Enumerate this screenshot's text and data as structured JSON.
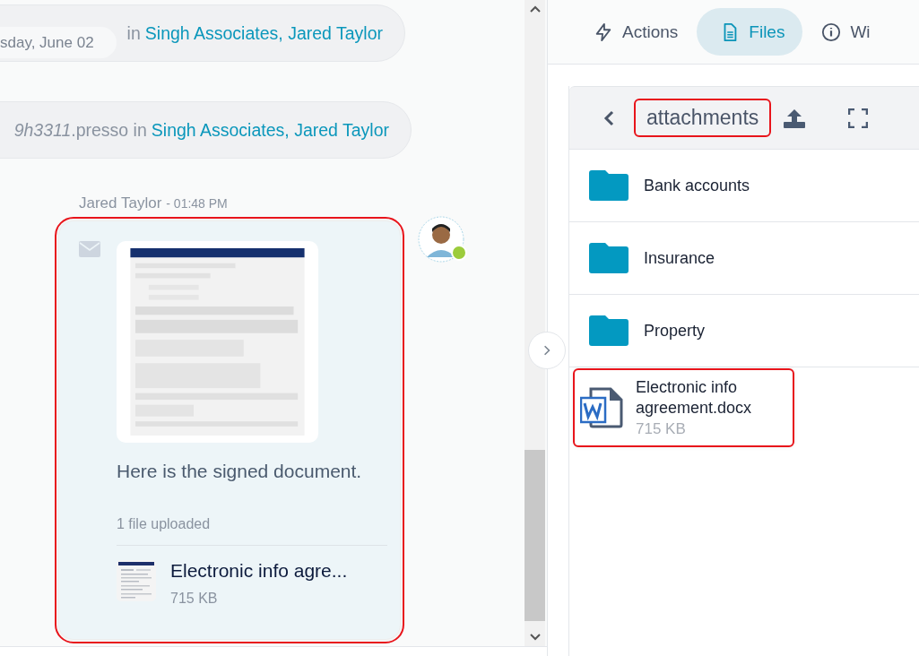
{
  "chat": {
    "date_pill": "sday, June 02",
    "events": [
      {
        "text": "in",
        "link": "Singh Associates, Jared Taylor"
      },
      {
        "text": "*9h3311*.presso in",
        "link": "Singh Associates, Jared Taylor"
      }
    ],
    "message": {
      "author": "Jared Taylor",
      "time": "- 01:48 PM",
      "highlighted": true,
      "body": "Here is the signed document.",
      "upload_note": "1 file uploaded",
      "attachment": {
        "name": "Electronic info agre...",
        "size": "715 KB"
      }
    },
    "avatar": {
      "online": true
    }
  },
  "tabs": [
    {
      "label": "Actions",
      "selected": false
    },
    {
      "label": "Files",
      "selected": true
    },
    {
      "label": "Wi",
      "selected": false
    }
  ],
  "file_browser": {
    "title": "attachments",
    "title_highlighted": true,
    "items": [
      {
        "kind": "folder",
        "name": "Bank accounts",
        "highlighted": false
      },
      {
        "kind": "folder",
        "name": "Insurance",
        "highlighted": false
      },
      {
        "kind": "folder",
        "name": "Property",
        "highlighted": false
      },
      {
        "kind": "word",
        "name": "Electronic info agreement.docx",
        "size": "715 KB",
        "highlighted": true
      }
    ]
  }
}
